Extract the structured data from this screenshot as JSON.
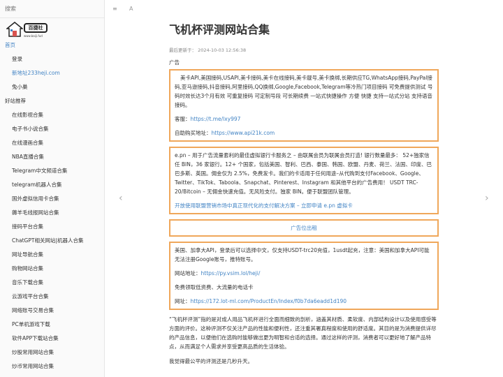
{
  "search": {
    "placeholder": "搜索"
  },
  "logo": {
    "badge": "百捷社",
    "url": "www.baiji.fud"
  },
  "nav": [
    {
      "label": "首页",
      "level": "top",
      "state": "active"
    },
    {
      "label": "登录",
      "level": "sub",
      "state": ""
    },
    {
      "label": "新地址233heji.com",
      "level": "sub",
      "state": "link"
    },
    {
      "label": "兔小巢",
      "level": "sub",
      "state": ""
    },
    {
      "label": "好站推荐",
      "level": "top",
      "state": ""
    },
    {
      "label": "在线影视合集",
      "level": "sub",
      "state": ""
    },
    {
      "label": "电子书小说合集",
      "level": "sub",
      "state": ""
    },
    {
      "label": "在线漫画合集",
      "level": "sub",
      "state": ""
    },
    {
      "label": "NBA直播合集",
      "level": "sub",
      "state": ""
    },
    {
      "label": "Telegram中文频道合集",
      "level": "sub",
      "state": ""
    },
    {
      "label": "telegram机器人合集",
      "level": "sub",
      "state": ""
    },
    {
      "label": "国外虚拟信用卡合集",
      "level": "sub",
      "state": ""
    },
    {
      "label": "薅羊毛线报网站合集",
      "level": "sub",
      "state": ""
    },
    {
      "label": "接码平台合集",
      "level": "sub",
      "state": ""
    },
    {
      "label": "ChatGPT相关网站|机器人合集",
      "level": "sub",
      "state": ""
    },
    {
      "label": "网址导航合集",
      "level": "sub",
      "state": ""
    },
    {
      "label": "购物网站合集",
      "level": "sub",
      "state": ""
    },
    {
      "label": "音乐下载合集",
      "level": "sub",
      "state": ""
    },
    {
      "label": "云游戏平台合集",
      "level": "sub",
      "state": ""
    },
    {
      "label": "网络账号交易合集",
      "level": "sub",
      "state": ""
    },
    {
      "label": "PC单机游戏下载",
      "level": "sub",
      "state": ""
    },
    {
      "label": "软件APP下载站合集",
      "level": "sub",
      "state": ""
    },
    {
      "label": "炒股常用网站合集",
      "level": "sub",
      "state": ""
    },
    {
      "label": "炒币常用网站合集",
      "level": "sub",
      "state": ""
    }
  ],
  "toolbar": {
    "menu_icon": "≡",
    "font_icon": "A"
  },
  "arrows": {
    "prev": "‹",
    "next": "›"
  },
  "article": {
    "title": "飞机杯评测网站合集",
    "updated": "最后更新于： 2024-10-03 12:56:38",
    "ad_label": "广告",
    "ad1_text": "美卡API,美国接码,USAPI,美卡接码,美卡在线接码,美卡靓号,美卡换绑,长期供应TG,WhatsApp接码,PayPal接码,亚马逊接码,抖音接码,阿里接码,QQ换绑,Google,Facebook,Telegram等冷热门项目接码 可免费提供测试 号码时效长达3个月有效 可重复接码 可定制号段 可长期续费 一站式快捷操作 方便 快捷 支持一站式分站 支持语音接码。",
    "ad1_service_label": "客服：",
    "ad1_service_link": "https://t.me/lxy997",
    "ad1_buy_label": "自助购买地址：",
    "ad1_buy_link": "https://www.api21k.com",
    "ad2_text": "e.pn – 用于广告流量套利的最佳虚拟银行卡服务之 – 由联属会员为联属会员打造! 银行数量最多： 52+独家信任 BIN，36 家银行。12+ 个国家，包括美国、智利、巴西、泰国、韩国、欧盟、丹麦、荷兰、法国、印度、巴巴多斯、英国。佣金仅为 2.5%，免费发卡。我们的卡适用于任何用途–从代购到支付Facebook、Google、Twitter、TikTok、Taboola、Snapchat、Pinterest、Instagram 和其他平台的广告费用！ USDT TRC-20/Bitcoin – 无佣金快速充值。无风险支付。独家 BIN。便于联盟团队管理。",
    "ad2_link": "开放使用联盟营销市场中真正现代化的支付解决方案 – 立即申请 e.pn 虚拟卡",
    "ad_slot": "广告位出租",
    "ad3_text": "美国、加拿大API，登录后可以选择中文，仅支持USDT-trc20充值，1usdt起充，注意：美国和加拿大API可能无法注册Google账号，推特账号。",
    "ad3_site_label": "网站地址：",
    "ad3_site_link": "https://py.vsim.lol/heji/",
    "ad3_free": "免费领取低资费、大流量的电话卡",
    "ad3_url_label": "网址：",
    "ad3_url_link": "https://172.lot-ml.com/ProductEn/Index/f0b7da6eadd1d190",
    "intro": "“飞机杯评测”指的是对成人用品飞机杯进行全面而细致的剖析，涵盖其材质、柔软度、内部结构设计以及使用感受等方面的评价。这种评测不仅关注产品的性能和便利性，还注重其署真程度和使用的舒适度。其目的是为消费提供详尽的产品信息，以便他们在选购时能够做出更为明智和合适的选择。通过这样的评测，消费者可以更好地了解产品特点，从而满足个人需求并享受更高品质的生活体验。",
    "closing": "我觉得最公平的评测还是几秒升天。"
  },
  "colors": {
    "accent": "#4183c4",
    "ad_border": "#f0a75a"
  }
}
